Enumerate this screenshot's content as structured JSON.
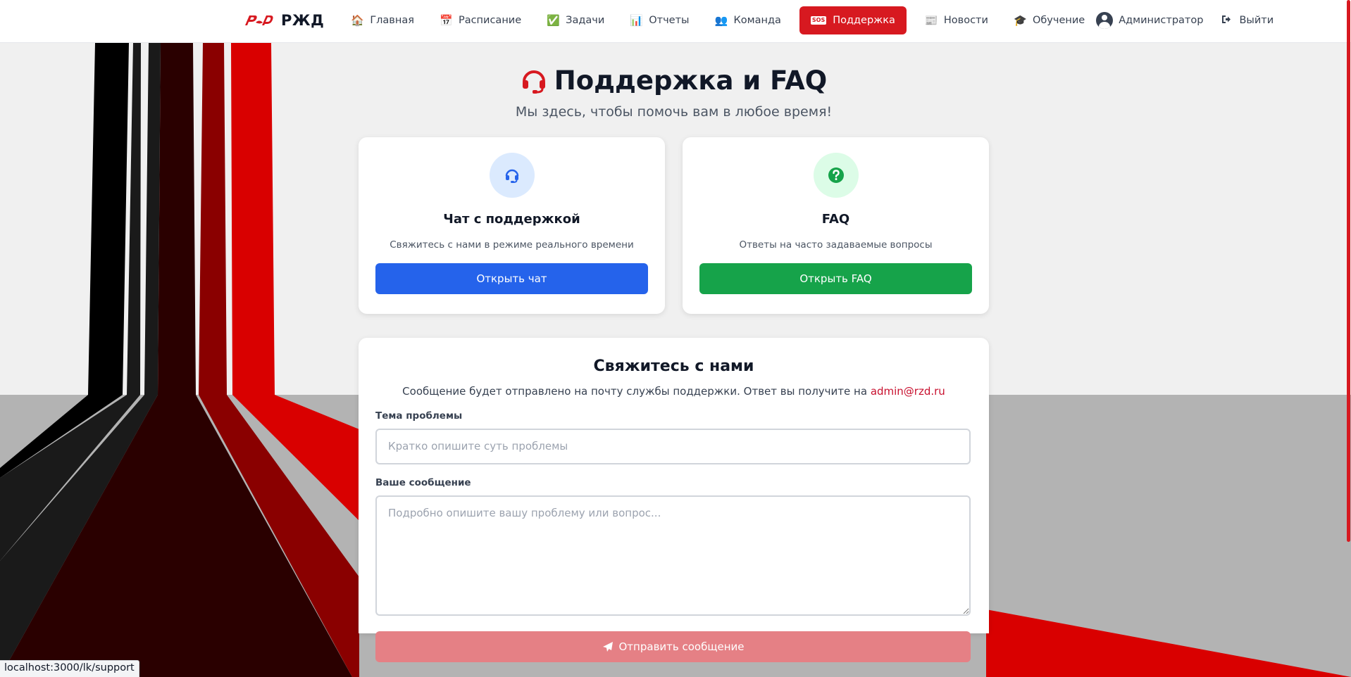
{
  "brand": {
    "name": "РЖД",
    "logo": "rzd-logo"
  },
  "nav": {
    "items": [
      {
        "label": "Главная",
        "icon": "🏠"
      },
      {
        "label": "Расписание",
        "icon": "📅"
      },
      {
        "label": "Задачи",
        "icon": "✅"
      },
      {
        "label": "Отчеты",
        "icon": "📊"
      },
      {
        "label": "Команда",
        "icon": "👥"
      },
      {
        "label": "Поддержка",
        "icon": "SOS",
        "active": true
      },
      {
        "label": "Новости",
        "icon": "📰"
      },
      {
        "label": "Обучение",
        "icon": "🎓"
      }
    ],
    "user": "Администратор",
    "logout": "Выйти"
  },
  "hero": {
    "title": "Поддержка и FAQ",
    "subtitle": "Мы здесь, чтобы помочь вам в любое время!"
  },
  "cards": {
    "chat": {
      "title": "Чат с поддержкой",
      "description": "Свяжитесь с нами в режиме реального времени",
      "button": "Открыть чат",
      "icon": "headset-icon"
    },
    "faq": {
      "title": "FAQ",
      "description": "Ответы на часто задаваемые вопросы",
      "button": "Открыть FAQ",
      "icon": "question-icon"
    }
  },
  "form": {
    "title": "Свяжитесь с нами",
    "subtitle": "Сообщение будет отправлено на почту службы поддержки. Ответ вы получите на",
    "email": "admin@rzd.ru",
    "subject_label": "Тема проблемы",
    "subject_placeholder": "Кратко опишите суть проблемы",
    "subject_value": "",
    "message_label": "Ваше сообщение",
    "message_placeholder": "Подробно опишите вашу проблему или вопрос...",
    "message_value": "",
    "submit": "Отправить сообщение"
  },
  "status_url": "localhost:3000/lk/support",
  "colors": {
    "brand_red": "#d71920",
    "blue": "#2563eb",
    "green": "#16a34a",
    "submit_disabled": "#e58085"
  }
}
